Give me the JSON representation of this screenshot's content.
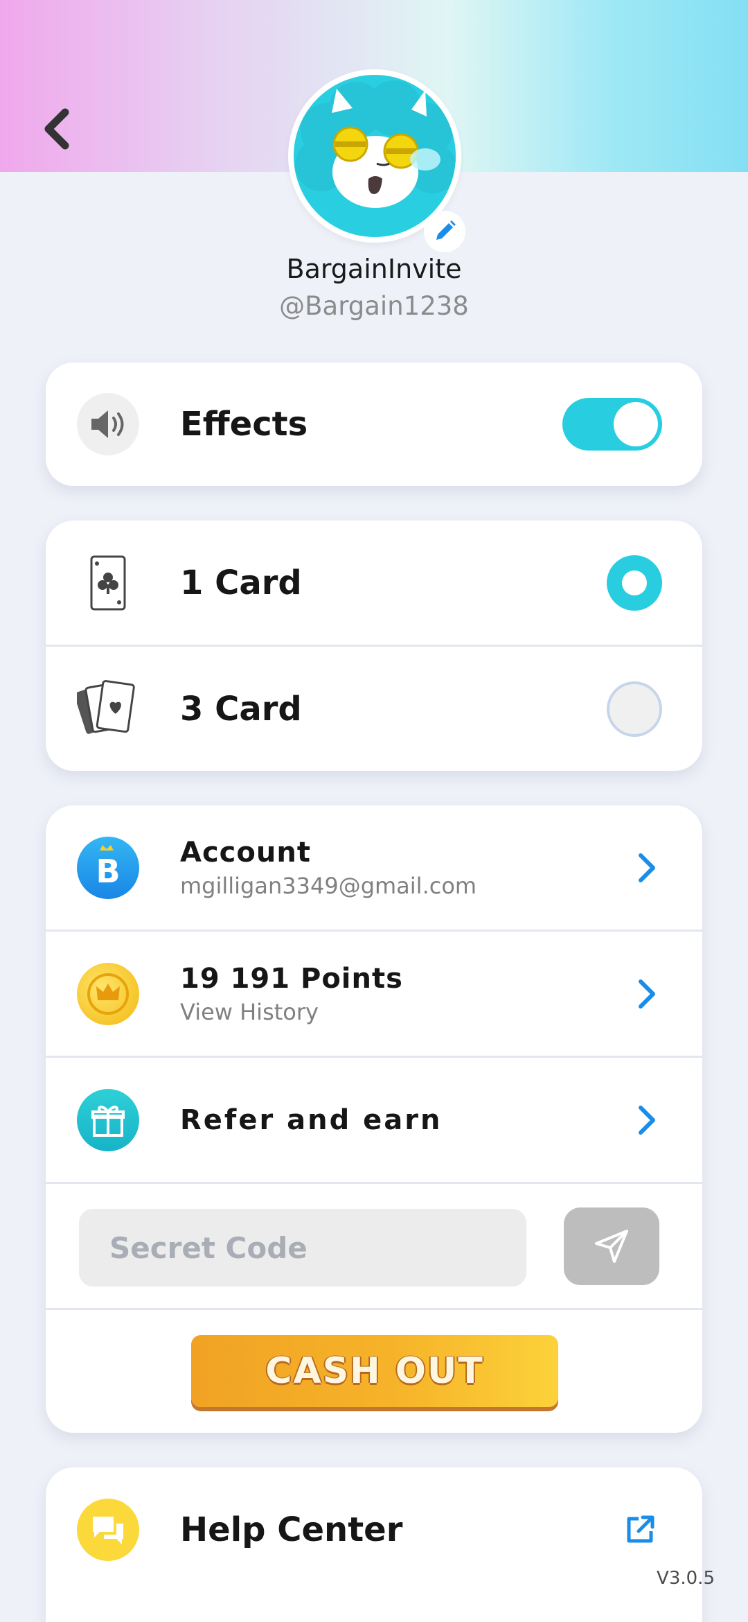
{
  "profile": {
    "display_name": "BargainInvite",
    "handle": "@Bargain1238"
  },
  "settings": {
    "effects_label": "Effects",
    "effects_on": true
  },
  "card_modes": {
    "one_card_label": "1 Card",
    "three_card_label": "3 Card",
    "selected": "1 Card"
  },
  "account": {
    "title": "Account",
    "email": "mgilligan3349@gmail.com"
  },
  "points": {
    "title": "19 191 Points",
    "subtitle": "View History"
  },
  "refer": {
    "title": "Refer and earn"
  },
  "secret_code": {
    "placeholder": "Secret Code",
    "value": ""
  },
  "cash_out": {
    "label": "CASH OUT"
  },
  "help": {
    "title": "Help Center"
  },
  "app": {
    "version": "V3.0.5"
  },
  "icons": {
    "back": "chevron-left-icon",
    "edit": "pencil-icon",
    "sound": "speaker-icon",
    "one_card": "club-card-icon",
    "three_card": "heart-cards-icon",
    "account": "b-crown-icon",
    "points": "gold-coin-crown-icon",
    "refer": "gift-icon",
    "send": "paper-plane-icon",
    "help": "chat-bubbles-icon",
    "external": "external-link-icon"
  },
  "colors": {
    "accent": "#28cde0",
    "link": "#1a8de8",
    "background": "#eef1f8"
  }
}
